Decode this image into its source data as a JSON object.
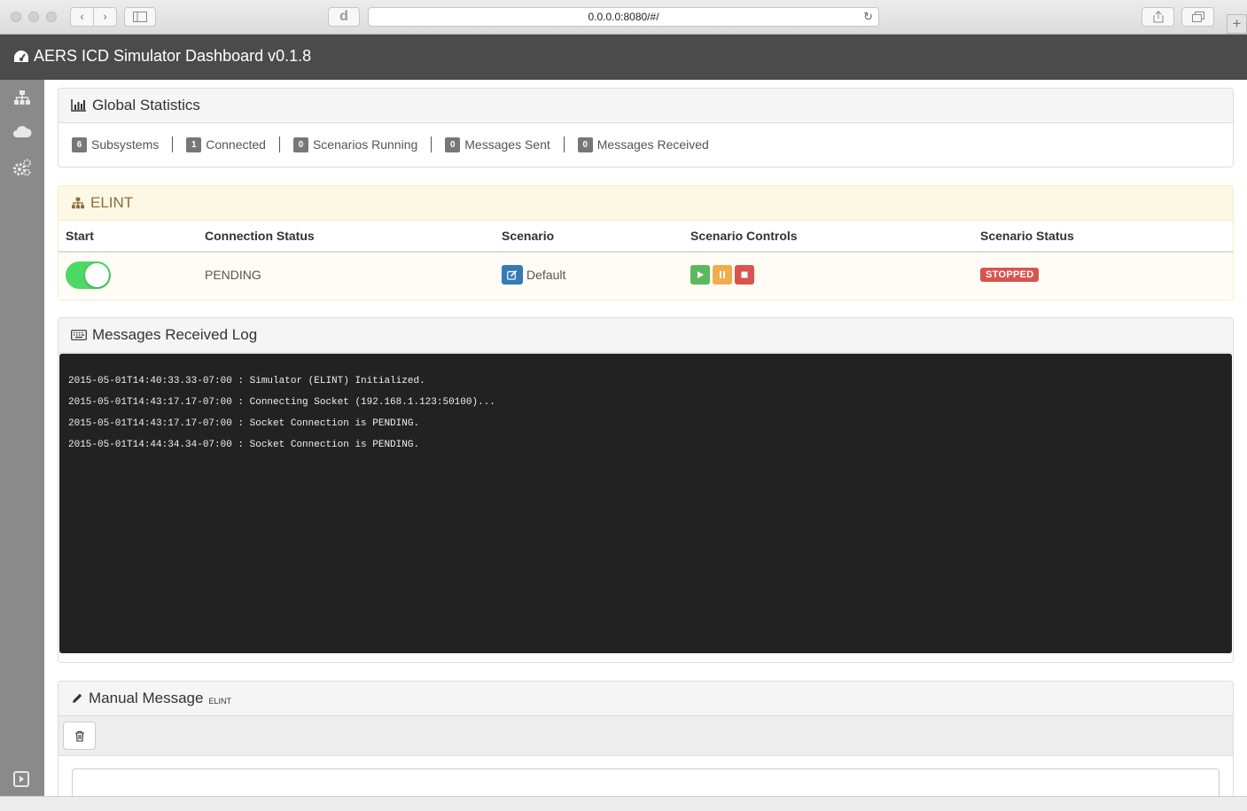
{
  "browser": {
    "url": "0.0.0.0:8080/#/"
  },
  "navbar": {
    "title": "AERS ICD Simulator Dashboard v0.1.8",
    "icon": "dashboard-icon"
  },
  "sidebar": {
    "items": [
      {
        "icon": "sitemap-icon"
      },
      {
        "icon": "cloud-icon"
      },
      {
        "icon": "cogs-icon"
      },
      {
        "icon": "play-square-icon"
      }
    ]
  },
  "global_stats": {
    "title": "Global Statistics",
    "items": [
      {
        "count": "6",
        "label": "Subsystems"
      },
      {
        "count": "1",
        "label": "Connected"
      },
      {
        "count": "0",
        "label": "Scenarios Running"
      },
      {
        "count": "0",
        "label": "Messages Sent"
      },
      {
        "count": "0",
        "label": "Messages Received"
      }
    ]
  },
  "subsystem": {
    "title": "ELINT",
    "columns": [
      "Start",
      "Connection Status",
      "Scenario",
      "Scenario Controls",
      "Scenario Status"
    ],
    "row": {
      "start_enabled": true,
      "connection_status": "PENDING",
      "scenario": "Default",
      "scenario_status": "STOPPED"
    },
    "colors": {
      "play": "#5cb85c",
      "pause": "#f0ad4e",
      "stop": "#d9534f",
      "toggle_on": "#4cd964"
    }
  },
  "log": {
    "title": "Messages Received Log",
    "lines": [
      "2015-05-01T14:40:33.33-07:00 : Simulator (ELINT) Initialized.",
      "2015-05-01T14:43:17.17-07:00 : Connecting Socket (192.168.1.123:50100)...",
      "2015-05-01T14:43:17.17-07:00 : Socket Connection is PENDING.",
      "2015-05-01T14:44:34.34-07:00 : Socket Connection is PENDING."
    ]
  },
  "manual": {
    "title": "Manual Message",
    "subtitle": "ELINT"
  }
}
